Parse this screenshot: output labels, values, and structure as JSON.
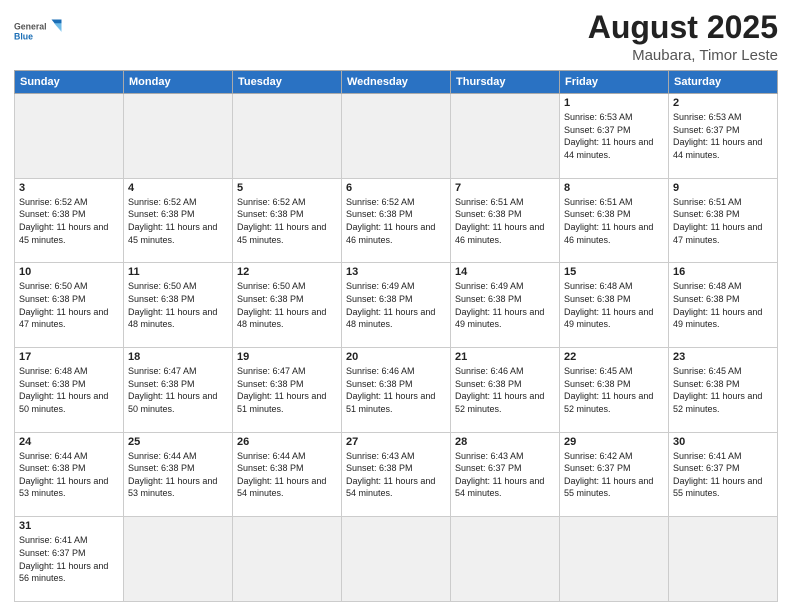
{
  "header": {
    "logo_general": "General",
    "logo_blue": "Blue",
    "month_year": "August 2025",
    "location": "Maubara, Timor Leste"
  },
  "weekdays": [
    "Sunday",
    "Monday",
    "Tuesday",
    "Wednesday",
    "Thursday",
    "Friday",
    "Saturday"
  ],
  "weeks": [
    [
      {
        "day": "",
        "info": ""
      },
      {
        "day": "",
        "info": ""
      },
      {
        "day": "",
        "info": ""
      },
      {
        "day": "",
        "info": ""
      },
      {
        "day": "",
        "info": ""
      },
      {
        "day": "1",
        "info": "Sunrise: 6:53 AM\nSunset: 6:37 PM\nDaylight: 11 hours\nand 44 minutes."
      },
      {
        "day": "2",
        "info": "Sunrise: 6:53 AM\nSunset: 6:37 PM\nDaylight: 11 hours\nand 44 minutes."
      }
    ],
    [
      {
        "day": "3",
        "info": "Sunrise: 6:52 AM\nSunset: 6:38 PM\nDaylight: 11 hours\nand 45 minutes."
      },
      {
        "day": "4",
        "info": "Sunrise: 6:52 AM\nSunset: 6:38 PM\nDaylight: 11 hours\nand 45 minutes."
      },
      {
        "day": "5",
        "info": "Sunrise: 6:52 AM\nSunset: 6:38 PM\nDaylight: 11 hours\nand 45 minutes."
      },
      {
        "day": "6",
        "info": "Sunrise: 6:52 AM\nSunset: 6:38 PM\nDaylight: 11 hours\nand 46 minutes."
      },
      {
        "day": "7",
        "info": "Sunrise: 6:51 AM\nSunset: 6:38 PM\nDaylight: 11 hours\nand 46 minutes."
      },
      {
        "day": "8",
        "info": "Sunrise: 6:51 AM\nSunset: 6:38 PM\nDaylight: 11 hours\nand 46 minutes."
      },
      {
        "day": "9",
        "info": "Sunrise: 6:51 AM\nSunset: 6:38 PM\nDaylight: 11 hours\nand 47 minutes."
      }
    ],
    [
      {
        "day": "10",
        "info": "Sunrise: 6:50 AM\nSunset: 6:38 PM\nDaylight: 11 hours\nand 47 minutes."
      },
      {
        "day": "11",
        "info": "Sunrise: 6:50 AM\nSunset: 6:38 PM\nDaylight: 11 hours\nand 48 minutes."
      },
      {
        "day": "12",
        "info": "Sunrise: 6:50 AM\nSunset: 6:38 PM\nDaylight: 11 hours\nand 48 minutes."
      },
      {
        "day": "13",
        "info": "Sunrise: 6:49 AM\nSunset: 6:38 PM\nDaylight: 11 hours\nand 48 minutes."
      },
      {
        "day": "14",
        "info": "Sunrise: 6:49 AM\nSunset: 6:38 PM\nDaylight: 11 hours\nand 49 minutes."
      },
      {
        "day": "15",
        "info": "Sunrise: 6:48 AM\nSunset: 6:38 PM\nDaylight: 11 hours\nand 49 minutes."
      },
      {
        "day": "16",
        "info": "Sunrise: 6:48 AM\nSunset: 6:38 PM\nDaylight: 11 hours\nand 49 minutes."
      }
    ],
    [
      {
        "day": "17",
        "info": "Sunrise: 6:48 AM\nSunset: 6:38 PM\nDaylight: 11 hours\nand 50 minutes."
      },
      {
        "day": "18",
        "info": "Sunrise: 6:47 AM\nSunset: 6:38 PM\nDaylight: 11 hours\nand 50 minutes."
      },
      {
        "day": "19",
        "info": "Sunrise: 6:47 AM\nSunset: 6:38 PM\nDaylight: 11 hours\nand 51 minutes."
      },
      {
        "day": "20",
        "info": "Sunrise: 6:46 AM\nSunset: 6:38 PM\nDaylight: 11 hours\nand 51 minutes."
      },
      {
        "day": "21",
        "info": "Sunrise: 6:46 AM\nSunset: 6:38 PM\nDaylight: 11 hours\nand 52 minutes."
      },
      {
        "day": "22",
        "info": "Sunrise: 6:45 AM\nSunset: 6:38 PM\nDaylight: 11 hours\nand 52 minutes."
      },
      {
        "day": "23",
        "info": "Sunrise: 6:45 AM\nSunset: 6:38 PM\nDaylight: 11 hours\nand 52 minutes."
      }
    ],
    [
      {
        "day": "24",
        "info": "Sunrise: 6:44 AM\nSunset: 6:38 PM\nDaylight: 11 hours\nand 53 minutes."
      },
      {
        "day": "25",
        "info": "Sunrise: 6:44 AM\nSunset: 6:38 PM\nDaylight: 11 hours\nand 53 minutes."
      },
      {
        "day": "26",
        "info": "Sunrise: 6:44 AM\nSunset: 6:38 PM\nDaylight: 11 hours\nand 54 minutes."
      },
      {
        "day": "27",
        "info": "Sunrise: 6:43 AM\nSunset: 6:38 PM\nDaylight: 11 hours\nand 54 minutes."
      },
      {
        "day": "28",
        "info": "Sunrise: 6:43 AM\nSunset: 6:37 PM\nDaylight: 11 hours\nand 54 minutes."
      },
      {
        "day": "29",
        "info": "Sunrise: 6:42 AM\nSunset: 6:37 PM\nDaylight: 11 hours\nand 55 minutes."
      },
      {
        "day": "30",
        "info": "Sunrise: 6:41 AM\nSunset: 6:37 PM\nDaylight: 11 hours\nand 55 minutes."
      }
    ],
    [
      {
        "day": "31",
        "info": "Sunrise: 6:41 AM\nSunset: 6:37 PM\nDaylight: 11 hours\nand 56 minutes."
      },
      {
        "day": "",
        "info": ""
      },
      {
        "day": "",
        "info": ""
      },
      {
        "day": "",
        "info": ""
      },
      {
        "day": "",
        "info": ""
      },
      {
        "day": "",
        "info": ""
      },
      {
        "day": "",
        "info": ""
      }
    ]
  ]
}
